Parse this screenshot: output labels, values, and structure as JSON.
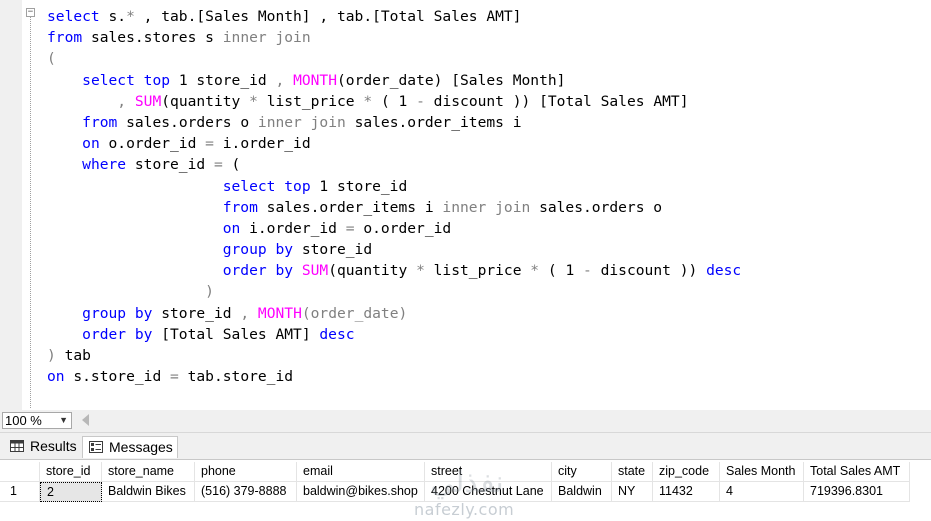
{
  "editor": {
    "lines": [
      [
        {
          "t": "select",
          "c": "kw"
        },
        {
          "t": " s."
        },
        {
          "t": "*",
          "c": "gr"
        },
        {
          "t": " , tab.[Sales Month] , tab.[Total Sales AMT]"
        }
      ],
      [
        {
          "t": "from",
          "c": "kw"
        },
        {
          "t": " sales.stores s "
        },
        {
          "t": "inner join",
          "c": "gr"
        }
      ],
      [
        {
          "t": "(",
          "c": "gr"
        }
      ],
      [
        {
          "t": "    "
        },
        {
          "t": "select",
          "c": "kw"
        },
        {
          "t": " "
        },
        {
          "t": "top",
          "c": "kw"
        },
        {
          "t": " 1 store_id "
        },
        {
          "t": ",",
          "c": "gr"
        },
        {
          "t": " "
        },
        {
          "t": "MONTH",
          "c": "fn"
        },
        {
          "t": "(order_date) [Sales Month]"
        }
      ],
      [
        {
          "t": "        "
        },
        {
          "t": ",",
          "c": "gr"
        },
        {
          "t": " "
        },
        {
          "t": "SUM",
          "c": "fn"
        },
        {
          "t": "(quantity "
        },
        {
          "t": "*",
          "c": "gr"
        },
        {
          "t": " list_price "
        },
        {
          "t": "*",
          "c": "gr"
        },
        {
          "t": " ( 1 "
        },
        {
          "t": "-",
          "c": "gr"
        },
        {
          "t": " discount )) [Total Sales AMT]"
        }
      ],
      [
        {
          "t": "    "
        },
        {
          "t": "from",
          "c": "kw"
        },
        {
          "t": " sales.orders o "
        },
        {
          "t": "inner join",
          "c": "gr"
        },
        {
          "t": " sales.order_items i"
        }
      ],
      [
        {
          "t": "    "
        },
        {
          "t": "on",
          "c": "kw"
        },
        {
          "t": " o.order_id "
        },
        {
          "t": "=",
          "c": "gr"
        },
        {
          "t": " i.order_id"
        }
      ],
      [
        {
          "t": "    "
        },
        {
          "t": "where",
          "c": "kw"
        },
        {
          "t": " store_id "
        },
        {
          "t": "=",
          "c": "gr"
        },
        {
          "t": " ("
        }
      ],
      [
        {
          "t": "                    "
        },
        {
          "t": "select",
          "c": "kw"
        },
        {
          "t": " "
        },
        {
          "t": "top",
          "c": "kw"
        },
        {
          "t": " 1 store_id"
        }
      ],
      [
        {
          "t": "                    "
        },
        {
          "t": "from",
          "c": "kw"
        },
        {
          "t": " sales.order_items i "
        },
        {
          "t": "inner join",
          "c": "gr"
        },
        {
          "t": " sales.orders o"
        }
      ],
      [
        {
          "t": "                    "
        },
        {
          "t": "on",
          "c": "kw"
        },
        {
          "t": " i.order_id "
        },
        {
          "t": "=",
          "c": "gr"
        },
        {
          "t": " o.order_id"
        }
      ],
      [
        {
          "t": "                    "
        },
        {
          "t": "group by",
          "c": "kw"
        },
        {
          "t": " store_id"
        }
      ],
      [
        {
          "t": "                    "
        },
        {
          "t": "order by",
          "c": "kw"
        },
        {
          "t": " "
        },
        {
          "t": "SUM",
          "c": "fn"
        },
        {
          "t": "(quantity "
        },
        {
          "t": "*",
          "c": "gr"
        },
        {
          "t": " list_price "
        },
        {
          "t": "*",
          "c": "gr"
        },
        {
          "t": " ( 1 "
        },
        {
          "t": "-",
          "c": "gr"
        },
        {
          "t": " discount )) "
        },
        {
          "t": "desc",
          "c": "kw"
        }
      ],
      [
        {
          "t": "                  "
        },
        {
          "t": ")",
          "c": "gr"
        }
      ],
      [
        {
          "t": "    "
        },
        {
          "t": "group by",
          "c": "kw"
        },
        {
          "t": " store_id "
        },
        {
          "t": ",",
          "c": "gr"
        },
        {
          "t": " "
        },
        {
          "t": "MONTH",
          "c": "fn"
        },
        {
          "t": "(order_date)",
          "c": "gr"
        }
      ],
      [
        {
          "t": "    "
        },
        {
          "t": "order by",
          "c": "kw"
        },
        {
          "t": " [Total Sales AMT] "
        },
        {
          "t": "desc",
          "c": "kw"
        }
      ],
      [
        {
          "t": ")",
          "c": "gr"
        },
        {
          "t": " tab"
        }
      ],
      [
        {
          "t": "on",
          "c": "kw"
        },
        {
          "t": " s.store_id "
        },
        {
          "t": "=",
          "c": "gr"
        },
        {
          "t": " tab.store_id"
        }
      ]
    ],
    "colors": {
      "keyword": "#0000ff",
      "function": "#ff00ff",
      "operator": "#808080"
    }
  },
  "status": {
    "zoom": "100 %"
  },
  "tabs": [
    {
      "label": "Results",
      "icon": "grid-icon"
    },
    {
      "label": "Messages",
      "icon": "messages-icon"
    }
  ],
  "results": {
    "columns": [
      "store_id",
      "store_name",
      "phone",
      "email",
      "street",
      "city",
      "state",
      "zip_code",
      "Sales Month",
      "Total Sales AMT"
    ],
    "rows": [
      {
        "num": "1",
        "cells": [
          "2",
          "Baldwin Bikes",
          "(516) 379-8888",
          "baldwin@bikes.shop",
          "4200 Chestnut Lane",
          "Baldwin",
          "NY",
          "11432",
          "4",
          "719396.8301"
        ]
      }
    ]
  },
  "watermark": {
    "text": "nafezly.com"
  }
}
